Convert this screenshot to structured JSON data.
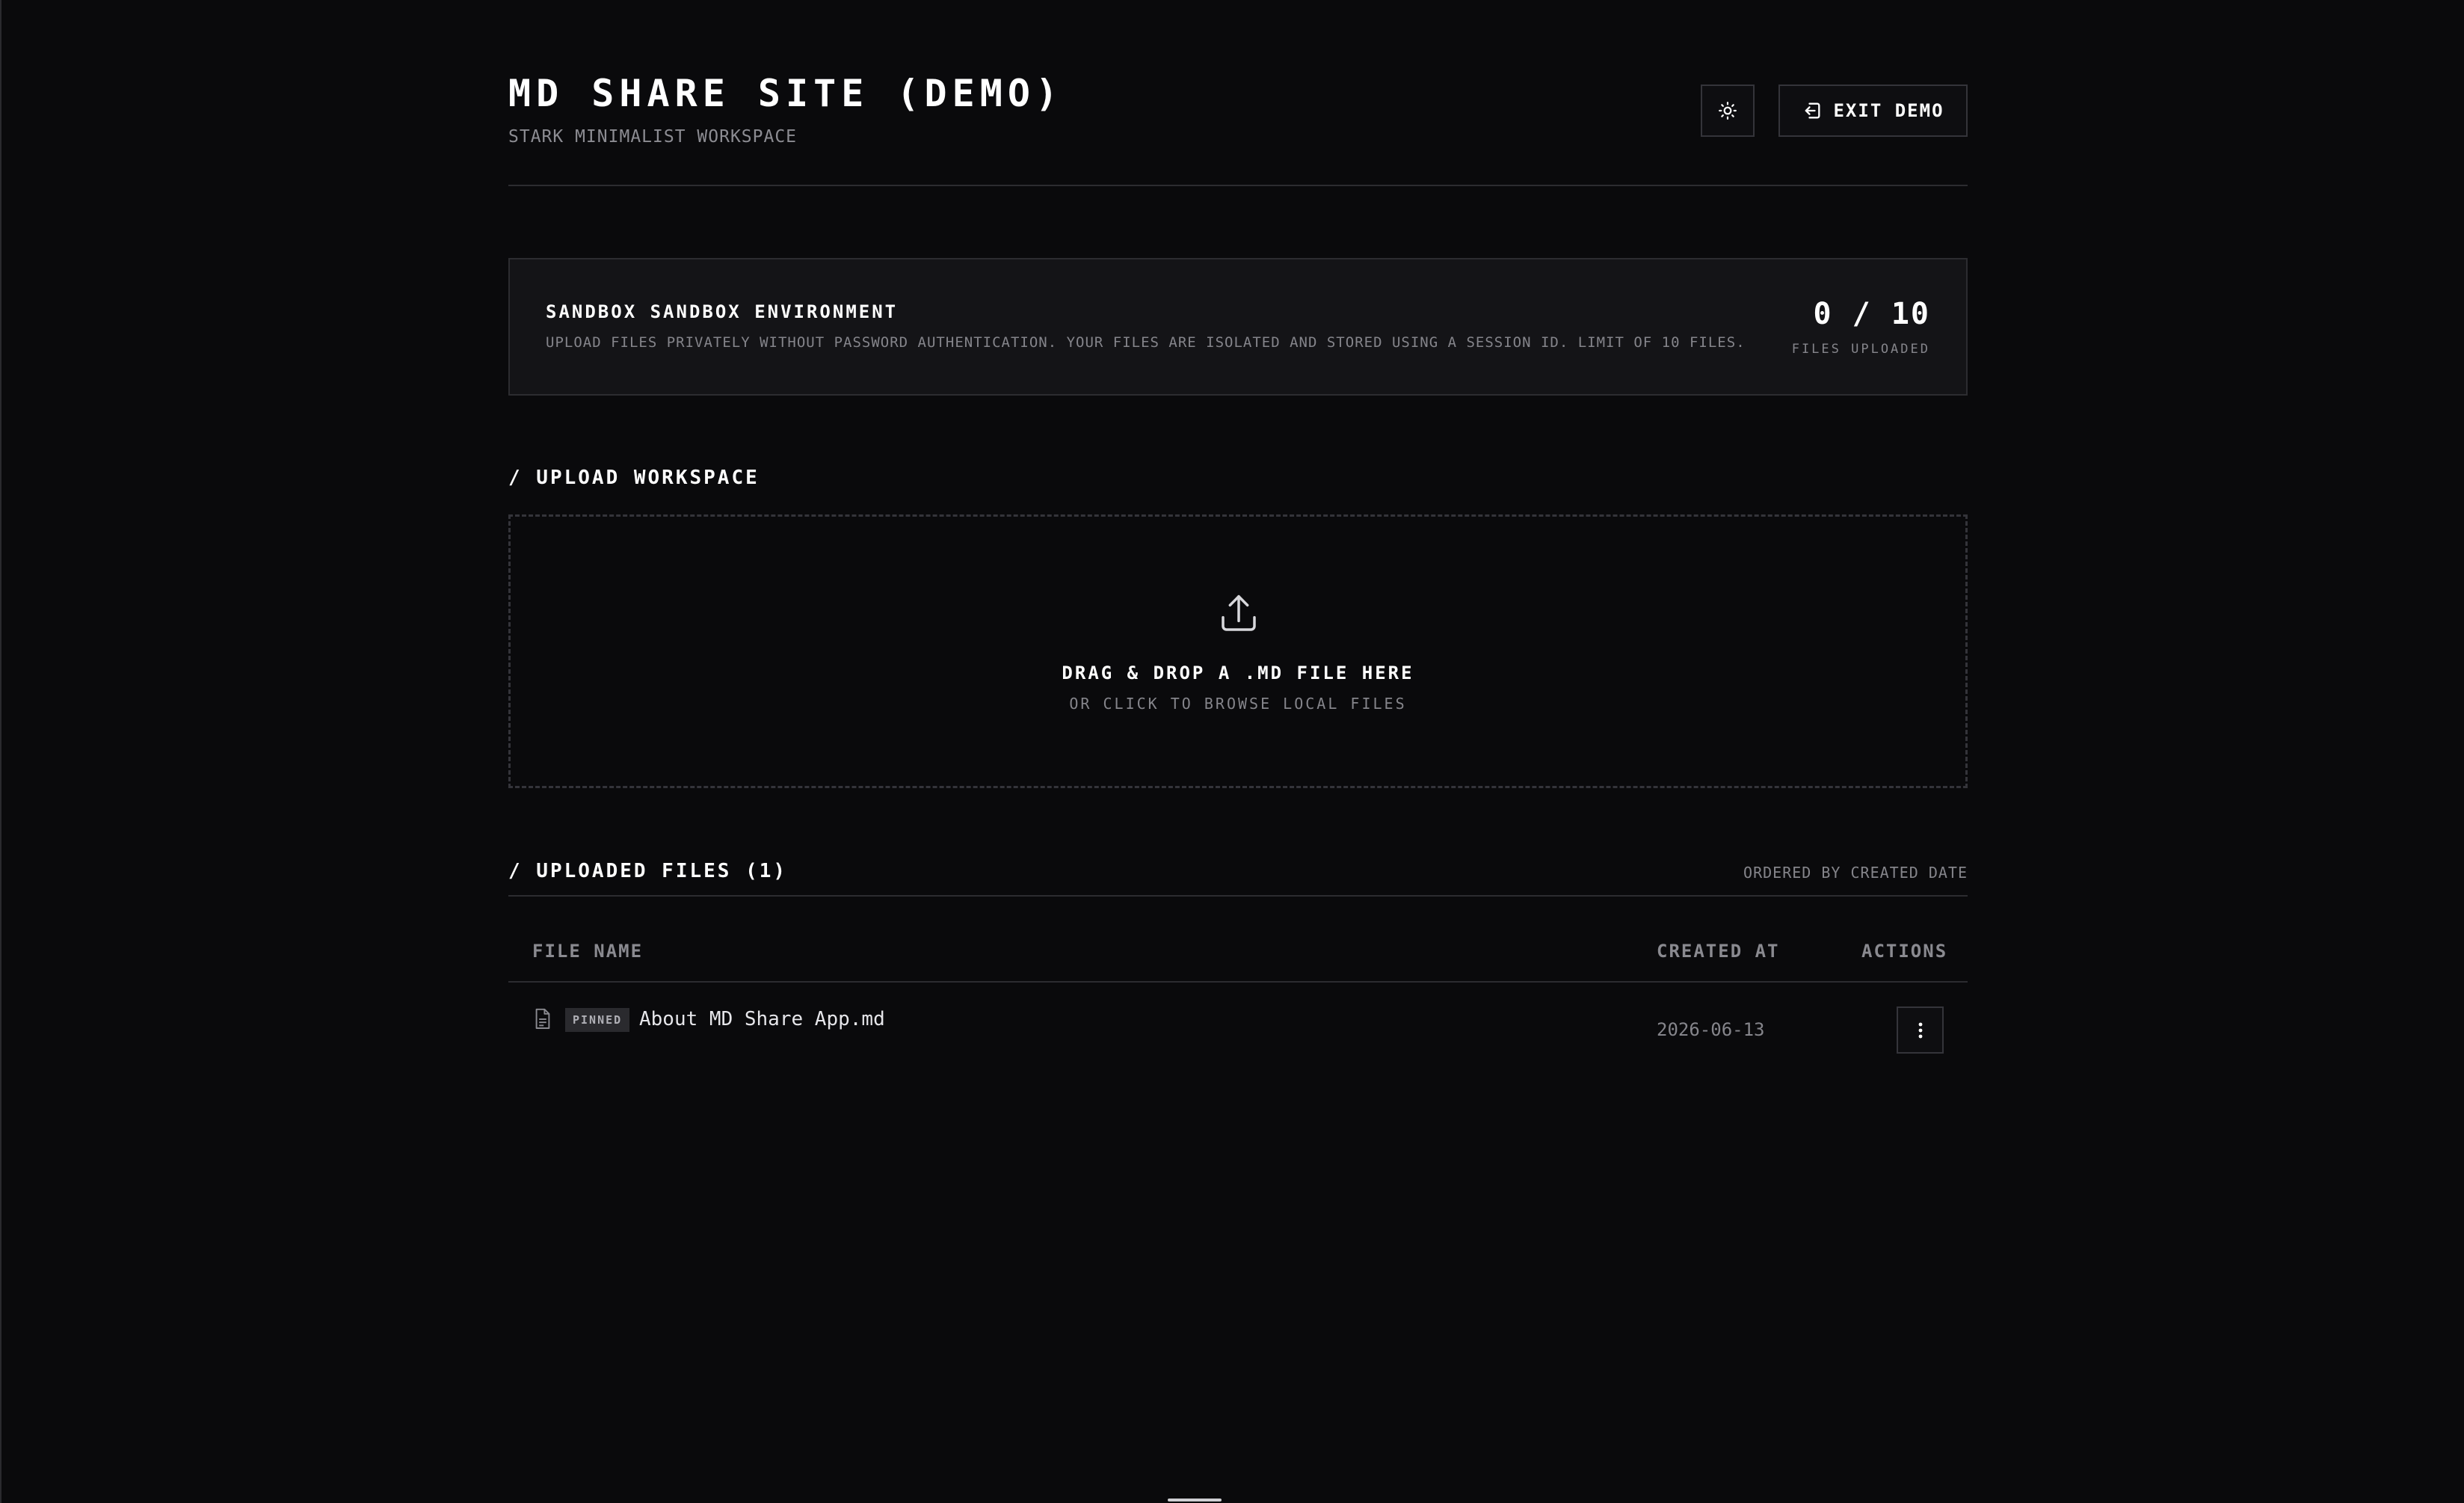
{
  "header": {
    "title": "MD SHARE SITE (DEMO)",
    "subtitle": "STARK MINIMALIST WORKSPACE",
    "theme_toggle_icon": "sun-icon",
    "exit_label": "EXIT DEMO",
    "exit_icon": "sign-out-icon"
  },
  "sandbox": {
    "title": "SANDBOX SANDBOX ENVIRONMENT",
    "description": "UPLOAD FILES PRIVATELY WITHOUT PASSWORD AUTHENTICATION. YOUR FILES ARE ISOLATED AND STORED USING A SESSION ID. LIMIT OF 10 FILES.",
    "counter": "0 / 10",
    "counter_label": "FILES UPLOADED"
  },
  "upload": {
    "heading": "/ UPLOAD WORKSPACE",
    "icon": "upload-icon",
    "drop_title": "DRAG & DROP A .MD FILE HERE",
    "drop_subtitle": "OR CLICK TO BROWSE LOCAL FILES"
  },
  "files": {
    "heading": "/ UPLOADED FILES (1)",
    "order_note": "ORDERED BY CREATED DATE",
    "columns": {
      "name": "FILE NAME",
      "created": "CREATED AT",
      "actions": "ACTIONS"
    },
    "rows": [
      {
        "badge": "PINNED",
        "name": "About MD Share App.md",
        "created_at": "2026-06-13",
        "icon": "file-icon",
        "action_icon": "more-vertical-icon"
      }
    ]
  },
  "colors": {
    "background": "#0a0a0c",
    "card": "#141417",
    "border": "#2c2c30",
    "text": "#ffffff",
    "muted": "#85858b"
  }
}
